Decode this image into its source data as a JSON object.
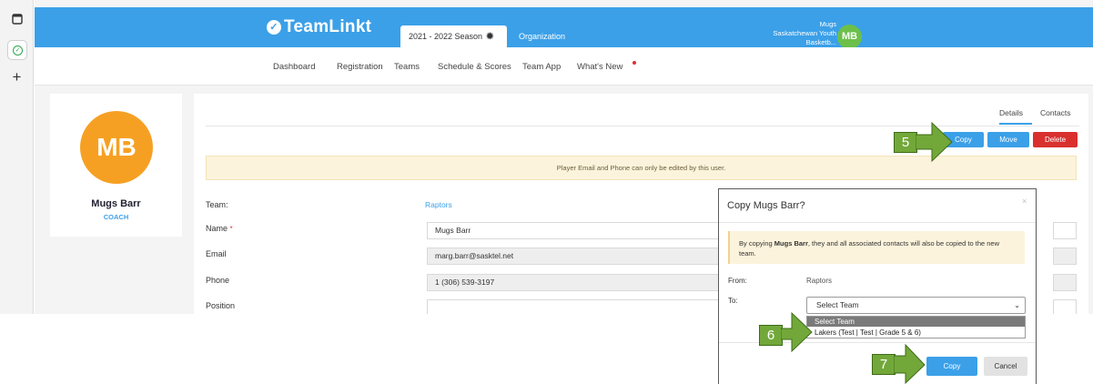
{
  "brand": {
    "name": "TeamLinkt",
    "primary": "#3ba0e8",
    "accent_green": "#6cc04a",
    "avatar_orange": "#f6a023"
  },
  "rail": {
    "icons": [
      "window-icon",
      "check-circle-icon",
      "plus-icon"
    ],
    "plus_glyph": "+"
  },
  "header": {
    "season_label": "2021 - 2022 Season",
    "org_label": "Organization",
    "user_name": "Mugs",
    "user_org": "Saskatchewan Youth Basketb...",
    "user_initials": "MB"
  },
  "nav": {
    "items": [
      "Dashboard",
      "Registration",
      "Teams",
      "Schedule & Scores",
      "Team App",
      "What's New"
    ]
  },
  "profile": {
    "initials": "MB",
    "name": "Mugs Barr",
    "role": "COACH"
  },
  "panel": {
    "tabs": [
      "Details",
      "Contacts"
    ],
    "active_tab": "Details",
    "buttons": {
      "copy": "Copy",
      "move": "Move",
      "delete": "Delete"
    },
    "warning": "Player Email and Phone can only be edited by this user.",
    "team_label": "Team:",
    "team_value": "Raptors",
    "fields": [
      {
        "label": "Name",
        "required_mark": "*",
        "value": "Mugs Barr"
      },
      {
        "label": "Email",
        "value": "marg.barr@sasktel.net"
      },
      {
        "label": "Phone",
        "value": "1 (306) 539-3197"
      },
      {
        "label": "Position",
        "value": ""
      }
    ]
  },
  "modal": {
    "title": "Copy Mugs Barr?",
    "close": "×",
    "msg_prefix": "By copying ",
    "msg_name": "Mugs Barr",
    "msg_suffix": ", they and all associated contacts will also be copied to the new team.",
    "from_label": "From:",
    "from_value": "Raptors",
    "to_label": "To:",
    "select_value": "Select Team",
    "select_chevron": "⌄",
    "dropdown_options": [
      "Select Team",
      "Lakers (Test | Test | Grade 5 & 6)"
    ],
    "copy_label": "Copy",
    "cancel_label": "Cancel"
  },
  "markers": [
    "5",
    "6",
    "7"
  ]
}
